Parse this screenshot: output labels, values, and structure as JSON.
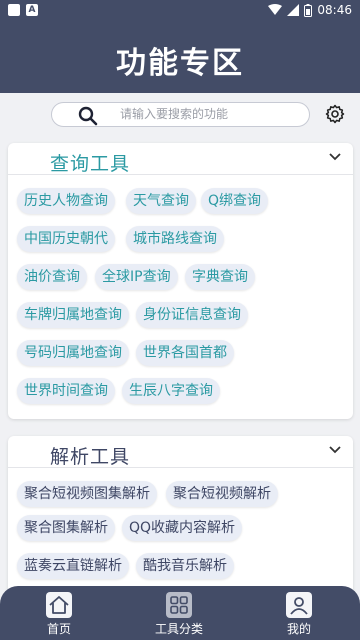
{
  "statusbar": {
    "time": "08:46",
    "left_icons": [
      "A"
    ]
  },
  "header": {
    "title": "功能专区"
  },
  "search": {
    "placeholder": "请输入要搜索的功能"
  },
  "sections": [
    {
      "title": "查询工具",
      "items": [
        "历史人物查询",
        "天气查询",
        "Q绑查询",
        "中国历史朝代",
        "城市路线查询",
        "油价查询",
        "全球IP查询",
        "字典查询",
        "车牌归属地查询",
        "身份证信息查询",
        "号码归属地查询",
        "世界各国首都",
        "世界时间查询",
        "生辰八字查询"
      ]
    },
    {
      "title": "解析工具",
      "items": [
        "聚合短视频图集解析",
        "聚合短视频解析",
        "聚合图集解析",
        "QQ收藏内容解析",
        "蓝奏云直链解析",
        "酷我音乐解析"
      ]
    }
  ],
  "bottom_nav": [
    {
      "label": "首页",
      "icon": "home-icon"
    },
    {
      "label": "工具分类",
      "icon": "grid-icon"
    },
    {
      "label": "我的",
      "icon": "user-icon"
    }
  ],
  "colors": {
    "header_bg": "#434c67",
    "accent_teal": "#2b9aa3",
    "tag_bg": "#e9edf6"
  }
}
